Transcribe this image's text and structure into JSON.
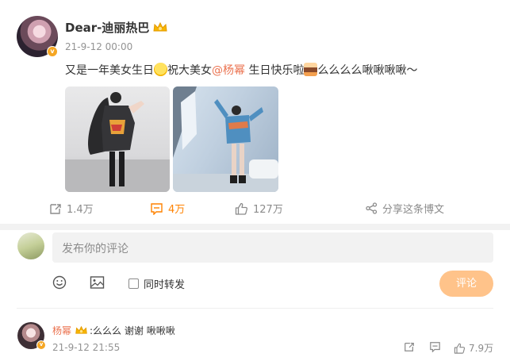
{
  "post": {
    "username": "Dear-迪丽热巴",
    "time": "21-9-12 00:00",
    "text_before": "又是一年美女生日",
    "text_mid": "祝大美女",
    "mention": "@杨幂",
    "text_after": " 生日快乐啦",
    "text_end": "么么么么啾啾啾啾～",
    "actions": {
      "repost": "1.4万",
      "comment": "4万",
      "like": "127万",
      "share": "分享这条博文"
    }
  },
  "composer": {
    "placeholder": "发布你的评论",
    "repost_option": "同时转发",
    "submit": "评论"
  },
  "comment": {
    "user": "杨幂",
    "text": ":么么么 谢谢 啾啾啾",
    "time": "21-9-12 21:55",
    "likes": "7.9万"
  },
  "colors": {
    "accent": "#ff8200",
    "mention": "#eb7350",
    "submit_disabled": "#ffc38a",
    "muted": "#939393"
  },
  "icons": [
    "verified-icon",
    "crown-icon",
    "repost-icon",
    "comment-icon",
    "like-icon",
    "share-icon",
    "emoji-icon",
    "image-icon"
  ]
}
